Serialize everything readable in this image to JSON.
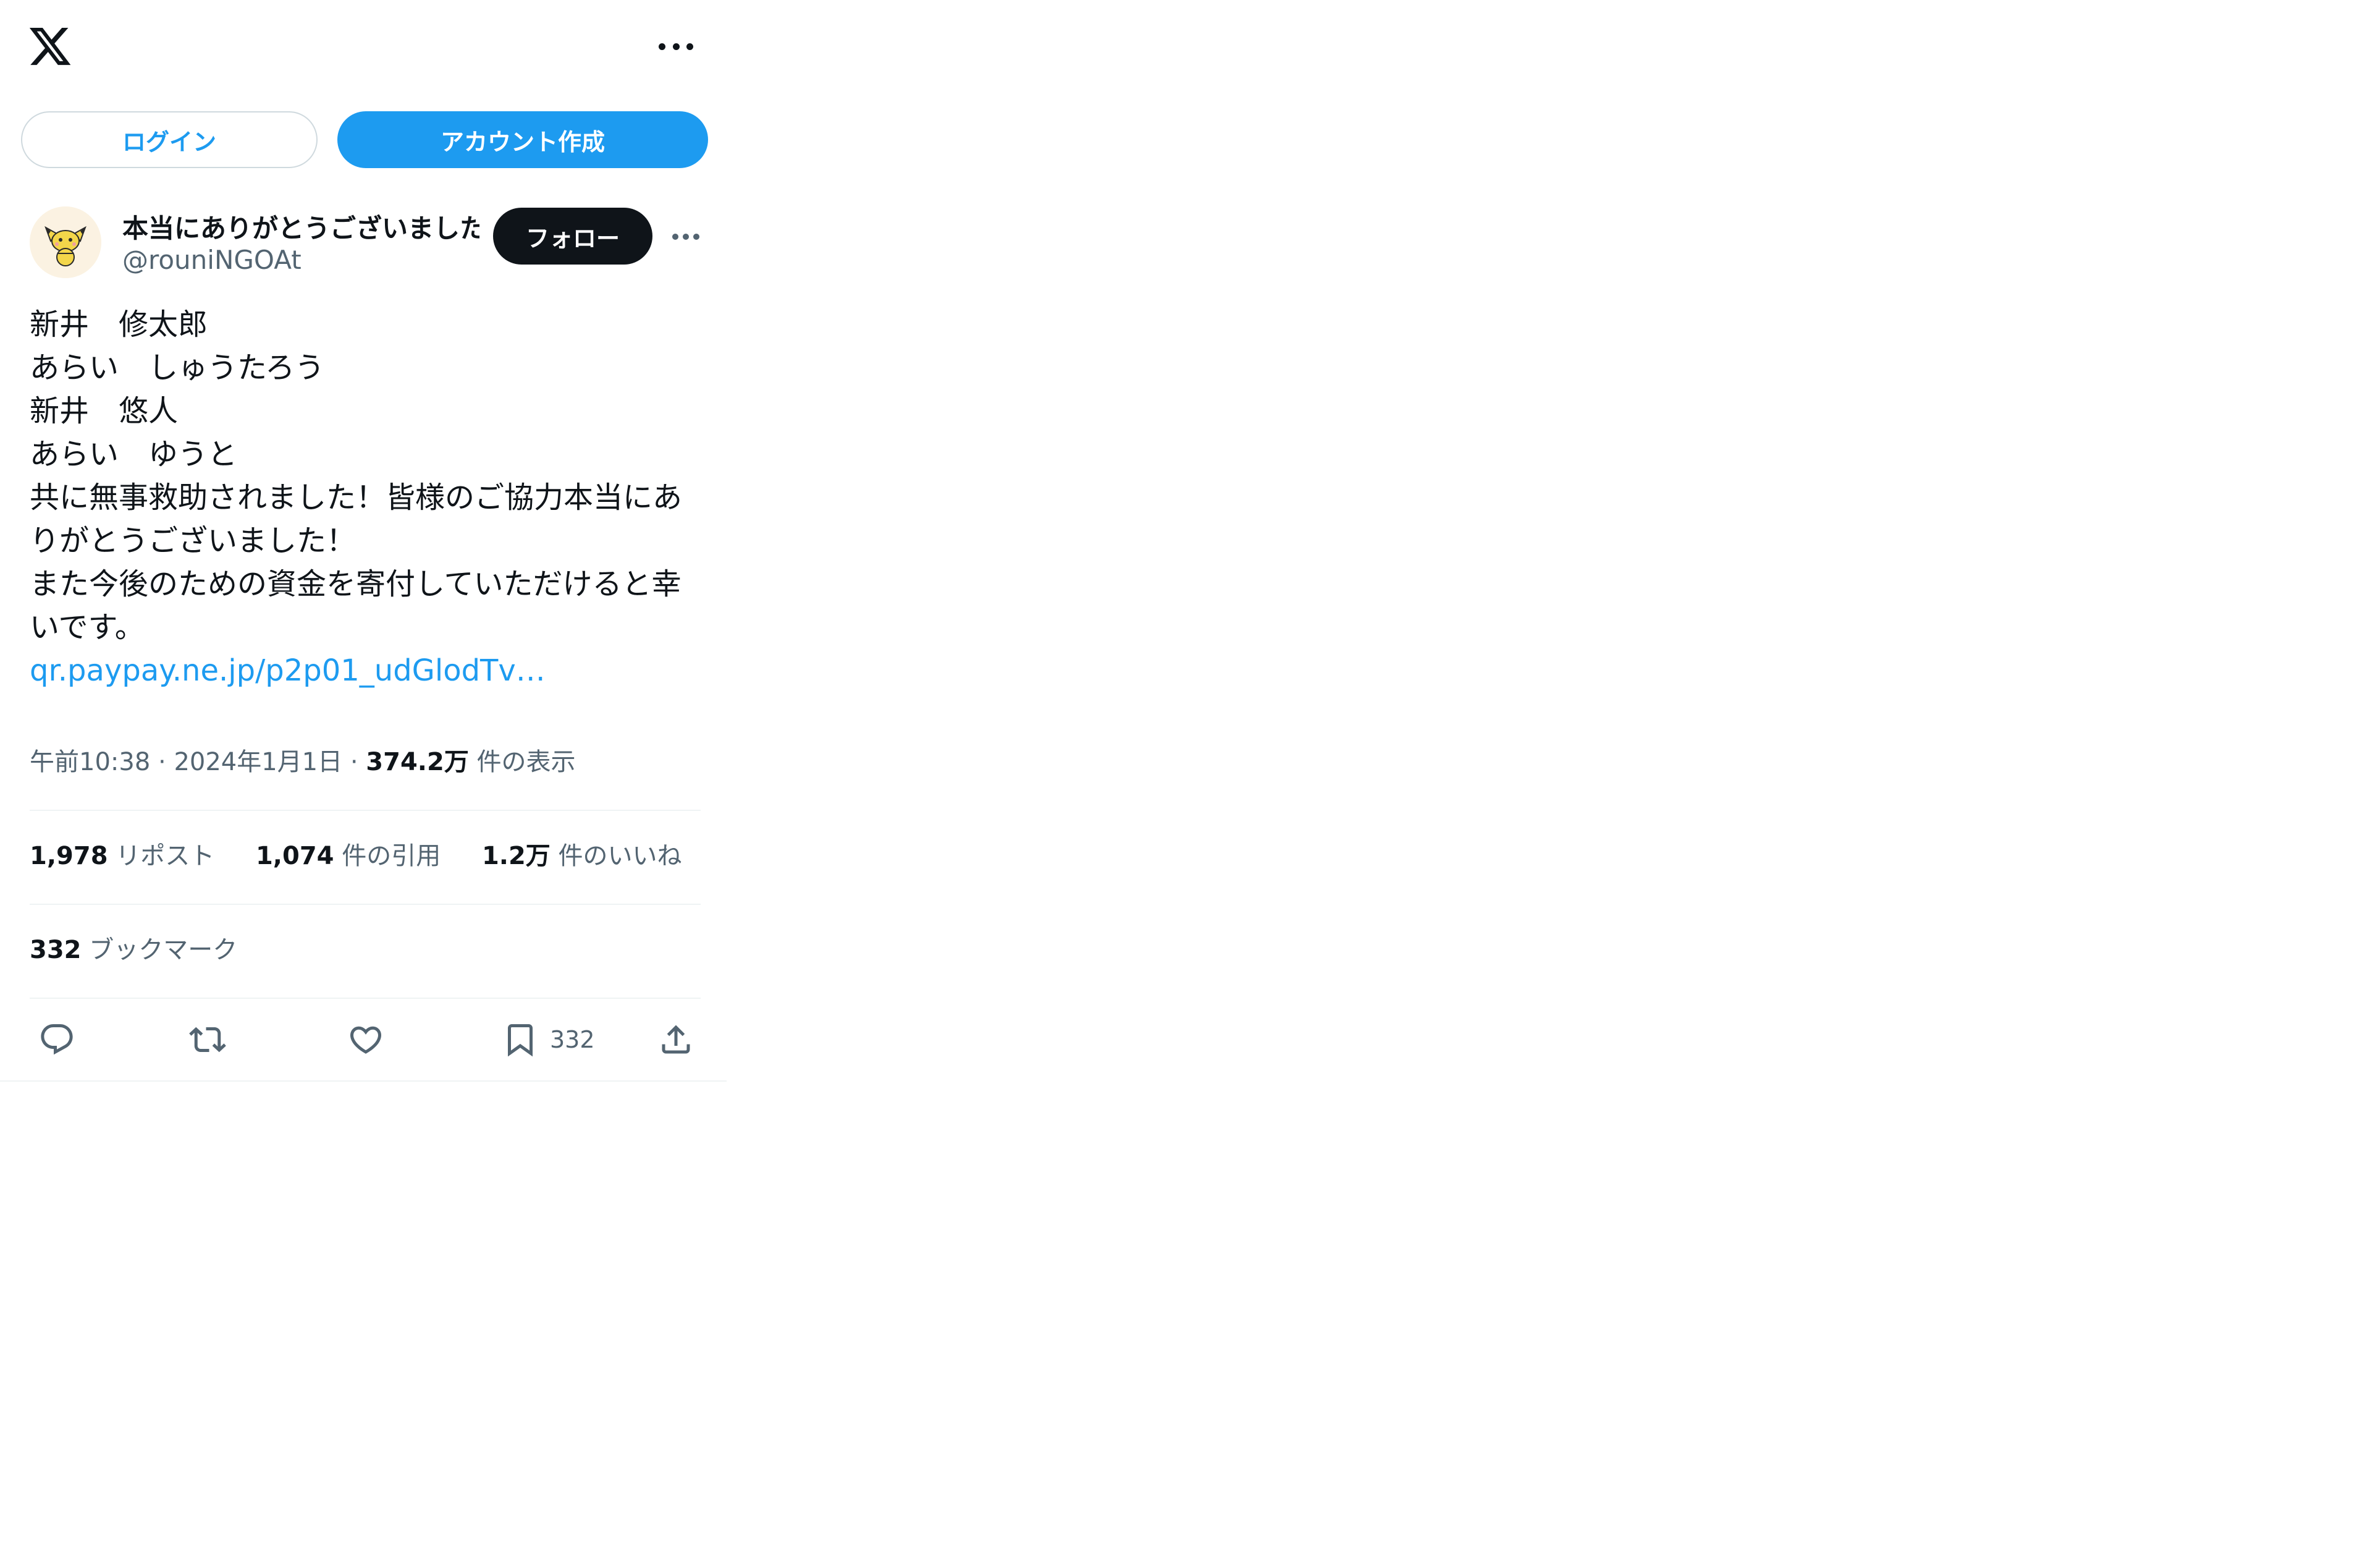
{
  "header": {
    "logo_icon": "x-logo-icon",
    "more_icon": "more-horizontal-icon"
  },
  "auth": {
    "login_label": "ログイン",
    "signup_label": "アカウント作成",
    "accent_color": "#1d9bf0"
  },
  "tweet": {
    "author": {
      "display_name": "本当にありがとうございました",
      "handle": "@rouniNGOAt",
      "follow_label": "フォロー",
      "avatar_icon": "pichu-avatar"
    },
    "lines": [
      "新井　修太郎",
      "あらい　しゅうたろう",
      "新井　悠人",
      "あらい　ゆうと",
      "共に無事救助されました！皆様のご協力本当にあ",
      "りがとうございました！",
      "また今後のための資金を寄付していただけると幸",
      "いです。"
    ],
    "link_text": "qr.paypay.ne.jp/p2p01_udGlodTv…",
    "time": "午前10:38",
    "date": "2024年1月1日",
    "views_count": "374.2万",
    "views_label": "件の表示",
    "stats": {
      "reposts_count": "1,978",
      "reposts_label": "リポスト",
      "quotes_count": "1,074",
      "quotes_label": "件の引用",
      "likes_count": "1.2万",
      "likes_label": "件のいいね",
      "bookmarks_count": "332",
      "bookmarks_label": "ブックマーク"
    },
    "actions": {
      "reply_icon": "reply-icon",
      "retweet_icon": "retweet-icon",
      "like_icon": "heart-icon",
      "bookmark_icon": "bookmark-icon",
      "bookmark_count": "332",
      "share_icon": "share-icon"
    }
  }
}
